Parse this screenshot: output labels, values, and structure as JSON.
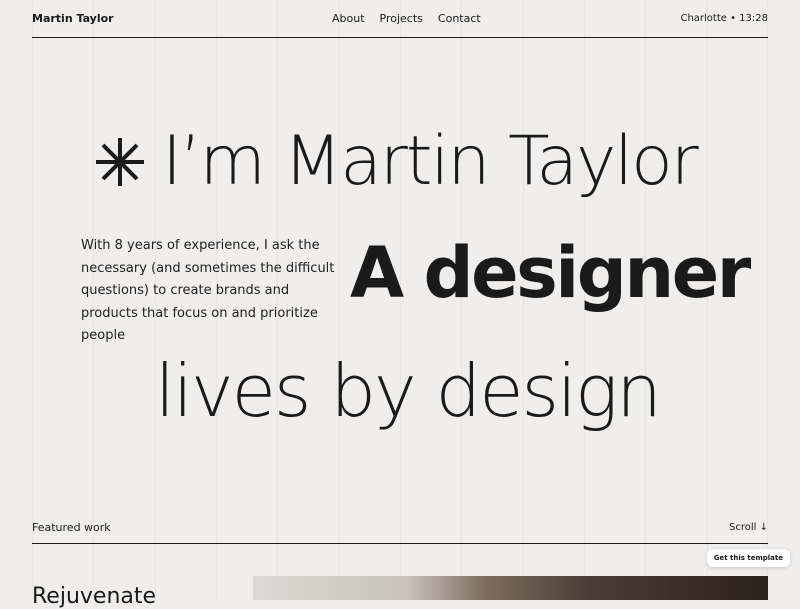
{
  "header": {
    "brand": "Martin Taylor",
    "nav": [
      "About",
      "Projects",
      "Contact"
    ],
    "location_time": "Charlotte • 13:28"
  },
  "hero": {
    "headline": "I’m Martin Taylor",
    "intro": "With 8 years of experience, I ask the necessary (and sometimes the difficult questions) to create brands and products that focus on and prioritize people",
    "designer": "A designer",
    "tagline": "lives by design"
  },
  "featured": {
    "label": "Featured work",
    "scroll": "Scroll ↓"
  },
  "template_badge": "Get this template",
  "project": {
    "title": "Rejuvenate"
  },
  "colors": {
    "background": "#efeeec",
    "text": "#1a1a1a"
  }
}
